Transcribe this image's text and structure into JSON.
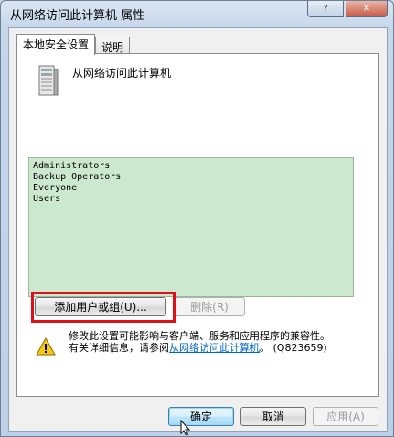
{
  "window": {
    "title": "从网络访问此计算机 属性"
  },
  "tabs": [
    {
      "label": "本地安全设置"
    },
    {
      "label": "说明"
    }
  ],
  "policy": {
    "name": "从网络访问此计算机",
    "icon": "server-icon"
  },
  "users": [
    "Administrators",
    "Backup Operators",
    "Everyone",
    "Users"
  ],
  "buttons": {
    "add": "添加用户或组(U)...",
    "remove": "删除(R)",
    "ok": "确定",
    "cancel": "取消",
    "apply": "应用(A)"
  },
  "warning": {
    "line1": "修改此设置可能影响与客户端、服务和应用程序的兼容性。",
    "line2_prefix": "有关详细信息，请参阅",
    "link": "从网络访问此计算机",
    "line2_suffix": "。 (Q823659)"
  },
  "colors": {
    "list_bg": "#cce8cf",
    "highlight": "#e0101a",
    "link": "#0066cc"
  }
}
